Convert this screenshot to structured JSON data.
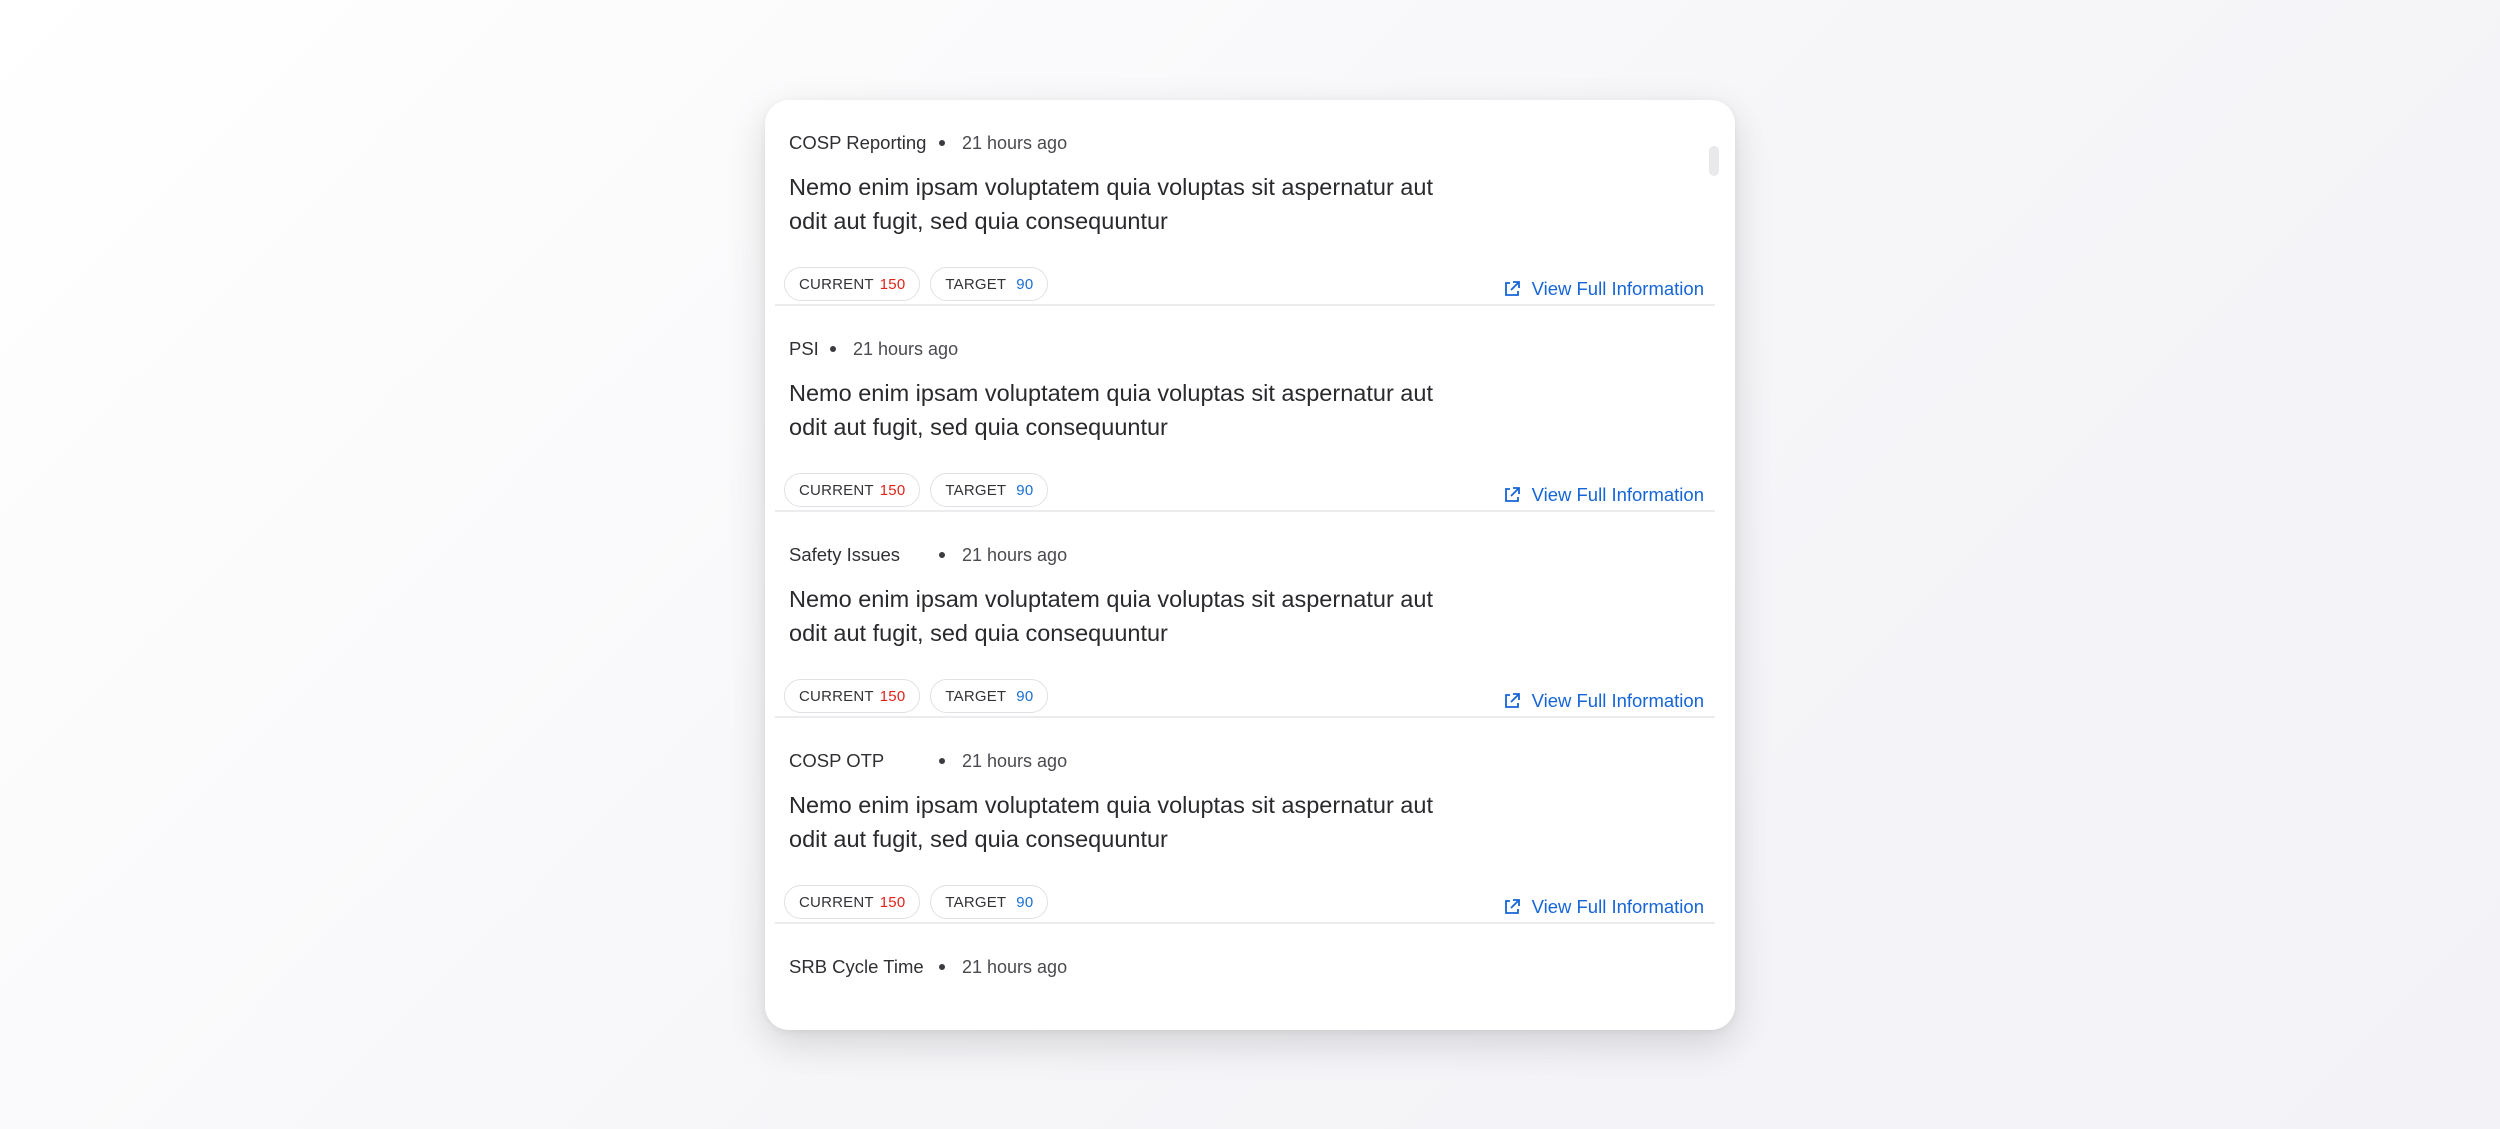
{
  "feed": {
    "items": [
      {
        "source": "COSP Reporting",
        "time": "21 hours ago",
        "text": "Nemo enim ipsam voluptatem quia voluptas sit aspernatur aut odit aut fugit, sed quia consequuntur",
        "current_label": "CURRENT",
        "current_value": "150",
        "target_label": "TARGET",
        "target_value": "90",
        "link_label": "View Full Information"
      },
      {
        "source": "PSI",
        "time": "21 hours ago",
        "text": "Nemo enim ipsam voluptatem quia voluptas sit aspernatur aut odit aut fugit, sed quia consequuntur",
        "current_label": "CURRENT",
        "current_value": "150",
        "target_label": "TARGET",
        "target_value": "90",
        "link_label": "View Full Information"
      },
      {
        "source": "Safety Issues",
        "time": "21 hours ago",
        "text": "Nemo enim ipsam voluptatem quia voluptas sit aspernatur aut odit aut fugit, sed quia consequuntur",
        "current_label": "CURRENT",
        "current_value": "150",
        "target_label": "TARGET",
        "target_value": "90",
        "link_label": "View Full Information"
      },
      {
        "source": "COSP OTP",
        "time": "21 hours ago",
        "text": "Nemo enim ipsam voluptatem quia voluptas sit aspernatur aut odit aut fugit, sed quia consequuntur",
        "current_label": "CURRENT",
        "current_value": "150",
        "target_label": "TARGET",
        "target_value": "90",
        "link_label": "View Full Information"
      },
      {
        "source": "SRB Cycle Time",
        "time": "21 hours ago"
      }
    ]
  },
  "colors": {
    "current_value": "#e0241b",
    "target_value": "#1b6fd6",
    "link": "#1565d8"
  },
  "icons": {
    "link_icon": "external-link-icon"
  }
}
